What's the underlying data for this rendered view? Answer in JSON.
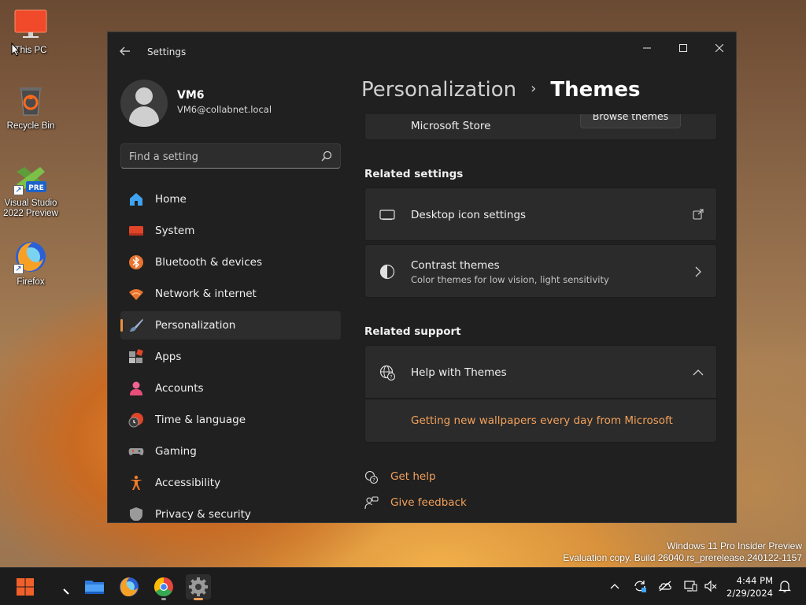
{
  "desktop": {
    "icons": [
      {
        "label": "This PC",
        "icon": "monitor-icon"
      },
      {
        "label": "Recycle Bin",
        "icon": "recycle-bin-icon"
      },
      {
        "label": "Visual Studio 2022 Preview",
        "icon": "visual-studio-icon",
        "badge": "PRE"
      },
      {
        "label": "Firefox",
        "icon": "firefox-icon"
      }
    ],
    "watermark": {
      "line1": "Windows 11 Pro Insider Preview",
      "line2": "Evaluation copy. Build 26040.rs_prerelease.240122-1157"
    }
  },
  "window": {
    "title": "Settings",
    "controls": {
      "minimize": "—",
      "maximize": "☐",
      "close": "✕"
    }
  },
  "profile": {
    "name": "VM6",
    "email": "VM6@collabnet.local"
  },
  "search": {
    "placeholder": "Find a setting"
  },
  "nav": {
    "items": [
      {
        "label": "Home",
        "icon": "home-icon"
      },
      {
        "label": "System",
        "icon": "system-icon"
      },
      {
        "label": "Bluetooth & devices",
        "icon": "bluetooth-icon"
      },
      {
        "label": "Network & internet",
        "icon": "wifi-icon"
      },
      {
        "label": "Personalization",
        "icon": "brush-icon",
        "active": true
      },
      {
        "label": "Apps",
        "icon": "apps-icon"
      },
      {
        "label": "Accounts",
        "icon": "accounts-icon"
      },
      {
        "label": "Time & language",
        "icon": "time-language-icon"
      },
      {
        "label": "Gaming",
        "icon": "gamepad-icon"
      },
      {
        "label": "Accessibility",
        "icon": "accessibility-icon"
      },
      {
        "label": "Privacy & security",
        "icon": "shield-icon"
      }
    ]
  },
  "main": {
    "breadcrumb": {
      "parent": "Personalization",
      "separator": "›",
      "current": "Themes"
    },
    "store_card": {
      "title": "Microsoft Store",
      "button": "Browse themes"
    },
    "related_settings": {
      "heading": "Related settings",
      "items": [
        {
          "title": "Desktop icon settings",
          "subtitle": "",
          "icon": "desktop-icon",
          "action": "external-link-icon"
        },
        {
          "title": "Contrast themes",
          "subtitle": "Color themes for low vision, light sensitivity",
          "icon": "contrast-icon",
          "action": "chevron-right-icon"
        }
      ]
    },
    "related_support": {
      "heading": "Related support",
      "expander_title": "Help with Themes",
      "link": "Getting new wallpapers every day from Microsoft"
    },
    "footer_links": {
      "get_help": "Get help",
      "give_feedback": "Give feedback"
    }
  },
  "taskbar": {
    "apps": [
      "start-icon",
      "search-icon",
      "file-explorer-icon",
      "firefox-icon",
      "chrome-icon",
      "settings-icon"
    ],
    "time": "4:44 PM",
    "date": "2/29/2024"
  },
  "colors": {
    "accent": "#f3a15a",
    "window_bg": "#202020",
    "card_bg": "#2b2b2b"
  }
}
